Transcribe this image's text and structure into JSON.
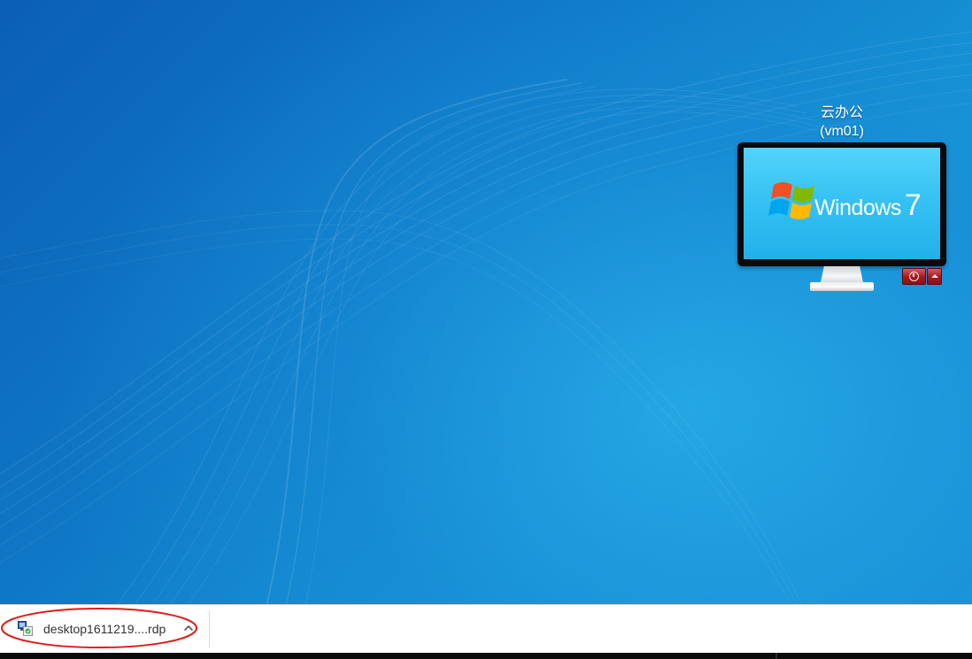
{
  "desktop": {
    "vm": {
      "title": "云办公",
      "subtitle": "(vm01)",
      "os_name": "Windows",
      "os_version": "7",
      "controls": [
        "power-icon",
        "caret-up-icon"
      ],
      "control_color": "#b3262a"
    }
  },
  "download_bar": {
    "item": {
      "filename": "desktop1611219....rdp",
      "icon": "remote-desktop-icon",
      "menu_icon": "chevron-up-icon"
    },
    "annotation_color": "#e01b1b"
  }
}
